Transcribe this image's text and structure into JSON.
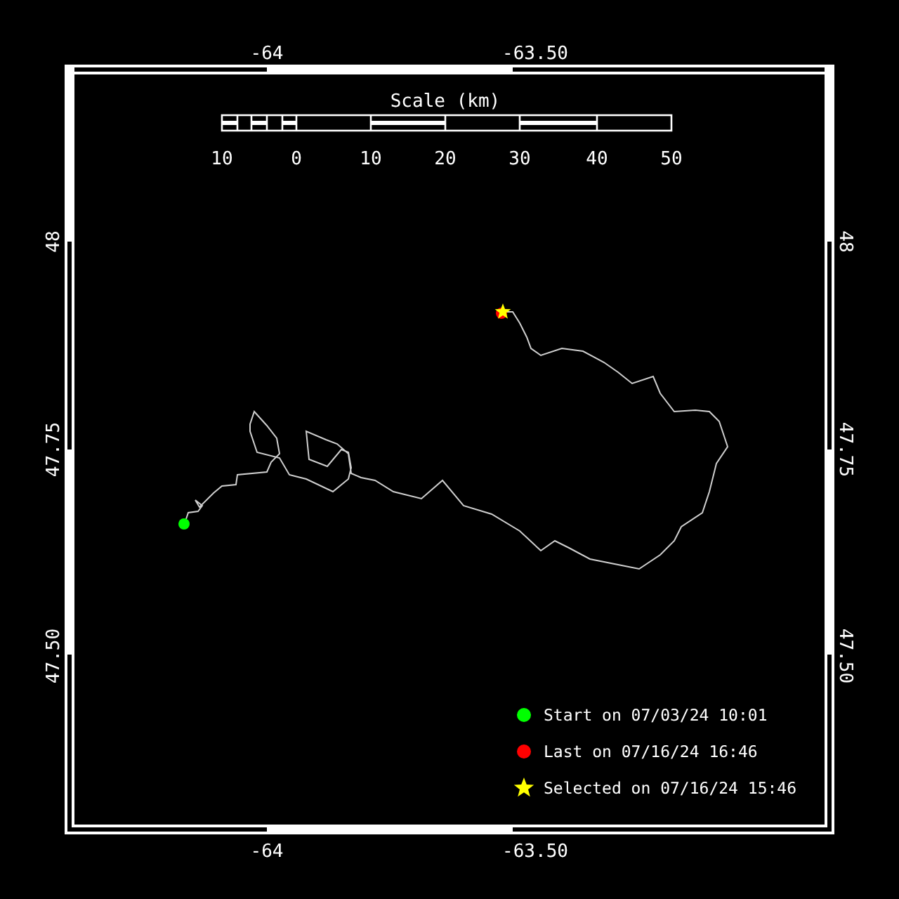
{
  "axes": {
    "top_ticks": [
      "-64",
      "-63.50"
    ],
    "bottom_ticks": [
      "-64",
      "-63.50"
    ],
    "left_ticks": [
      "48",
      "47.75",
      "47.50"
    ],
    "right_ticks": [
      "48",
      "47.75",
      "47.50"
    ]
  },
  "scale_bar": {
    "title": "Scale (km)",
    "labels": [
      "10",
      "0",
      "10",
      "20",
      "30",
      "40",
      "50"
    ]
  },
  "legend": [
    {
      "kind": "dot",
      "color": "#00ff00",
      "label": "Start on 07/03/24 10:01"
    },
    {
      "kind": "dot",
      "color": "#ff0000",
      "label": "Last on 07/16/24 16:46"
    },
    {
      "kind": "star",
      "color": "#ffff00",
      "label": "Selected on 07/16/24 15:46"
    }
  ]
}
